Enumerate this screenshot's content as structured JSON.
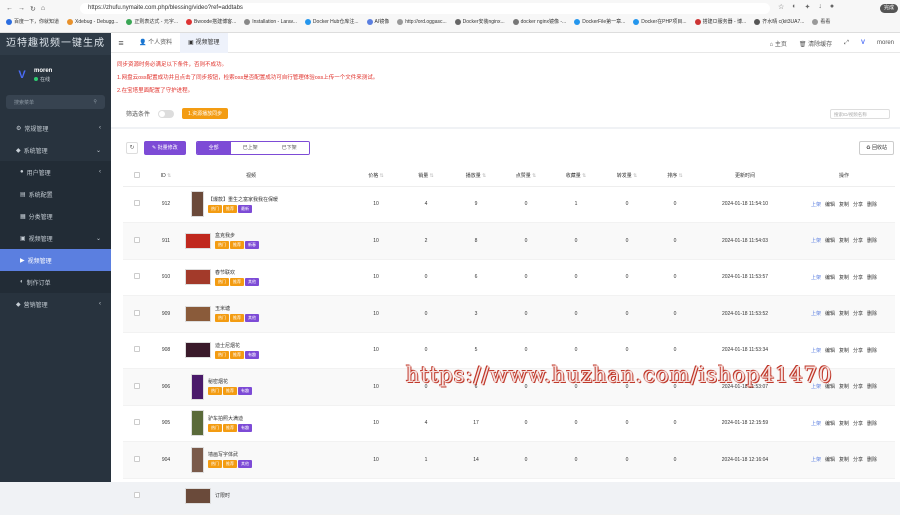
{
  "browser": {
    "url": "https://zhufu.nymaite.com.php/blessing/video?ref=addtabs",
    "finish": "完成",
    "bookmarks": [
      "百度一下，你就知道",
      "Xdebug - Debugg...",
      "正则表达式 - 元字...",
      "Bwoode搭建博客...",
      "Installation - Larav...",
      "Docker Hub仓库注...",
      "AI镜像",
      "http://ord.oggasc...",
      "Docker安装nginx...",
      "docker nginx镜像 -...",
      "DockerFile第一章...",
      "Docker在PHP项目...",
      "搭建CI服务器 - 博...",
      "齐水晴 c(kit3UA7...",
      "看看"
    ]
  },
  "sidebar": {
    "brand": "迈特趣视频一键生成",
    "user_name": "moren",
    "user_status": "在线",
    "search_placeholder": "搜索菜单",
    "items": [
      {
        "label": "常规管理",
        "icon": "⚙"
      },
      {
        "label": "系统管理",
        "icon": "◆"
      },
      {
        "label": "用户管理",
        "icon": "●"
      },
      {
        "label": "系统配置",
        "icon": "▤"
      },
      {
        "label": "分类管理",
        "icon": "▦"
      },
      {
        "label": "视频管理",
        "icon": "▣"
      },
      {
        "label": "视频管理",
        "icon": "▶"
      },
      {
        "label": "制作订单",
        "icon": "◐"
      },
      {
        "label": "营销管理",
        "icon": "◆"
      }
    ]
  },
  "topbar": {
    "tabs": [
      "个人资料",
      "视频管理"
    ],
    "right": [
      "主页",
      "清除缓存",
      "",
      "moren"
    ]
  },
  "notice": [
    "同步资源时务必满足以下条件，否则不成功。",
    "1.网盘云oss配置成功并且点击了同步按钮，检索oss是否配置成功可自行管理体验oss上传一个文件来测试。",
    "2.在宝塔里面配置了守护进程。"
  ],
  "filter": {
    "label": "筛选条件",
    "sync_button": "1.资源播放同步",
    "search_placeholder": "搜索ID/视频名称"
  },
  "toolbar": {
    "batch_edit": "批量修改",
    "segments": [
      "全部",
      "已上架",
      "已下架"
    ],
    "recycle": "回收站"
  },
  "table": {
    "headers": [
      "",
      "ID",
      "视频",
      "",
      "价格",
      "销量",
      "播放量",
      "点赞量",
      "收藏量",
      "转发量",
      "排序",
      "更新时间",
      "操作"
    ],
    "rows": [
      {
        "id": "912",
        "title": "【爆款】重生之富家我我在保暖",
        "tags": [
          [
            "热门",
            "t-hot"
          ],
          [
            "推荐",
            "t-rec"
          ],
          [
            "最新",
            "t-new"
          ]
        ],
        "thumb": "portrait",
        "tcolor": "#6b4a3a",
        "price": "10",
        "sales": "4",
        "plays": "9",
        "likes": "0",
        "favs": "1",
        "shares": "0",
        "sort": "0",
        "time": "2024-01-18 11:54:10"
      },
      {
        "id": "911",
        "title": "盒克我步",
        "tags": [
          [
            "热门",
            "t-hot"
          ],
          [
            "推荐",
            "t-rec"
          ],
          [
            "新春",
            "t-new"
          ]
        ],
        "thumb": "land",
        "tcolor": "#c0281e",
        "price": "10",
        "sales": "2",
        "plays": "8",
        "likes": "0",
        "favs": "0",
        "shares": "0",
        "sort": "0",
        "time": "2024-01-18 11:54:03"
      },
      {
        "id": "910",
        "title": "春节联欢",
        "tags": [
          [
            "热门",
            "t-hot"
          ],
          [
            "推荐",
            "t-rec"
          ],
          [
            "其他",
            "t-other"
          ]
        ],
        "thumb": "land",
        "tcolor": "#a33a2a",
        "price": "10",
        "sales": "0",
        "plays": "6",
        "likes": "0",
        "favs": "0",
        "shares": "0",
        "sort": "0",
        "time": "2024-01-18 11:53:57"
      },
      {
        "id": "909",
        "title": "玉米塘",
        "tags": [
          [
            "热门",
            "t-hot"
          ],
          [
            "推荐",
            "t-rec"
          ],
          [
            "其他",
            "t-other"
          ]
        ],
        "thumb": "land",
        "tcolor": "#8a5b3a",
        "price": "10",
        "sales": "0",
        "plays": "3",
        "likes": "0",
        "favs": "0",
        "shares": "0",
        "sort": "0",
        "time": "2024-01-18 11:53:52"
      },
      {
        "id": "908",
        "title": "迪士尼烟花",
        "tags": [
          [
            "热门",
            "t-hot"
          ],
          [
            "推荐",
            "t-rec"
          ],
          [
            "有趣",
            "t-hi"
          ]
        ],
        "thumb": "land",
        "tcolor": "#3a1a2a",
        "price": "10",
        "sales": "0",
        "plays": "5",
        "likes": "0",
        "favs": "0",
        "shares": "0",
        "sort": "0",
        "time": "2024-01-18 11:53:34"
      },
      {
        "id": "906",
        "title": "秘密烟花",
        "tags": [
          [
            "热门",
            "t-hot"
          ],
          [
            "推荐",
            "t-rec"
          ],
          [
            "有趣",
            "t-hi"
          ]
        ],
        "thumb": "portrait",
        "tcolor": "#4a1a6a",
        "price": "10",
        "sales": "0",
        "plays": "6",
        "likes": "0",
        "favs": "0",
        "shares": "0",
        "sort": "0",
        "time": "2024-01-18 11:53:07"
      },
      {
        "id": "905",
        "title": "驴车拍照大满迪",
        "tags": [
          [
            "热门",
            "t-hot"
          ],
          [
            "推荐",
            "t-rec"
          ],
          [
            "有趣",
            "t-hi"
          ]
        ],
        "thumb": "portrait",
        "tcolor": "#5a6a3a",
        "price": "10",
        "sales": "4",
        "plays": "17",
        "likes": "0",
        "favs": "0",
        "shares": "0",
        "sort": "0",
        "time": "2024-01-18 12:15:59"
      },
      {
        "id": "904",
        "title": "墙画写字体武",
        "tags": [
          [
            "热门",
            "t-hot"
          ],
          [
            "推荐",
            "t-rec"
          ],
          [
            "其他",
            "t-other"
          ]
        ],
        "thumb": "portrait",
        "tcolor": "#7a5a4a",
        "price": "10",
        "sales": "1",
        "plays": "14",
        "likes": "0",
        "favs": "0",
        "shares": "0",
        "sort": "0",
        "time": "2024-01-18 12:16:04"
      },
      {
        "id": "",
        "title": "订限时",
        "tags": [],
        "thumb": "land",
        "tcolor": "#6a4a3a",
        "price": "",
        "sales": "",
        "plays": "",
        "likes": "",
        "favs": "",
        "shares": "",
        "sort": "",
        "time": ""
      }
    ],
    "ops": [
      "上架",
      "编辑",
      "复制",
      "分享",
      "删除"
    ]
  },
  "watermark": "https://www.huzhan.com/ishop41470"
}
